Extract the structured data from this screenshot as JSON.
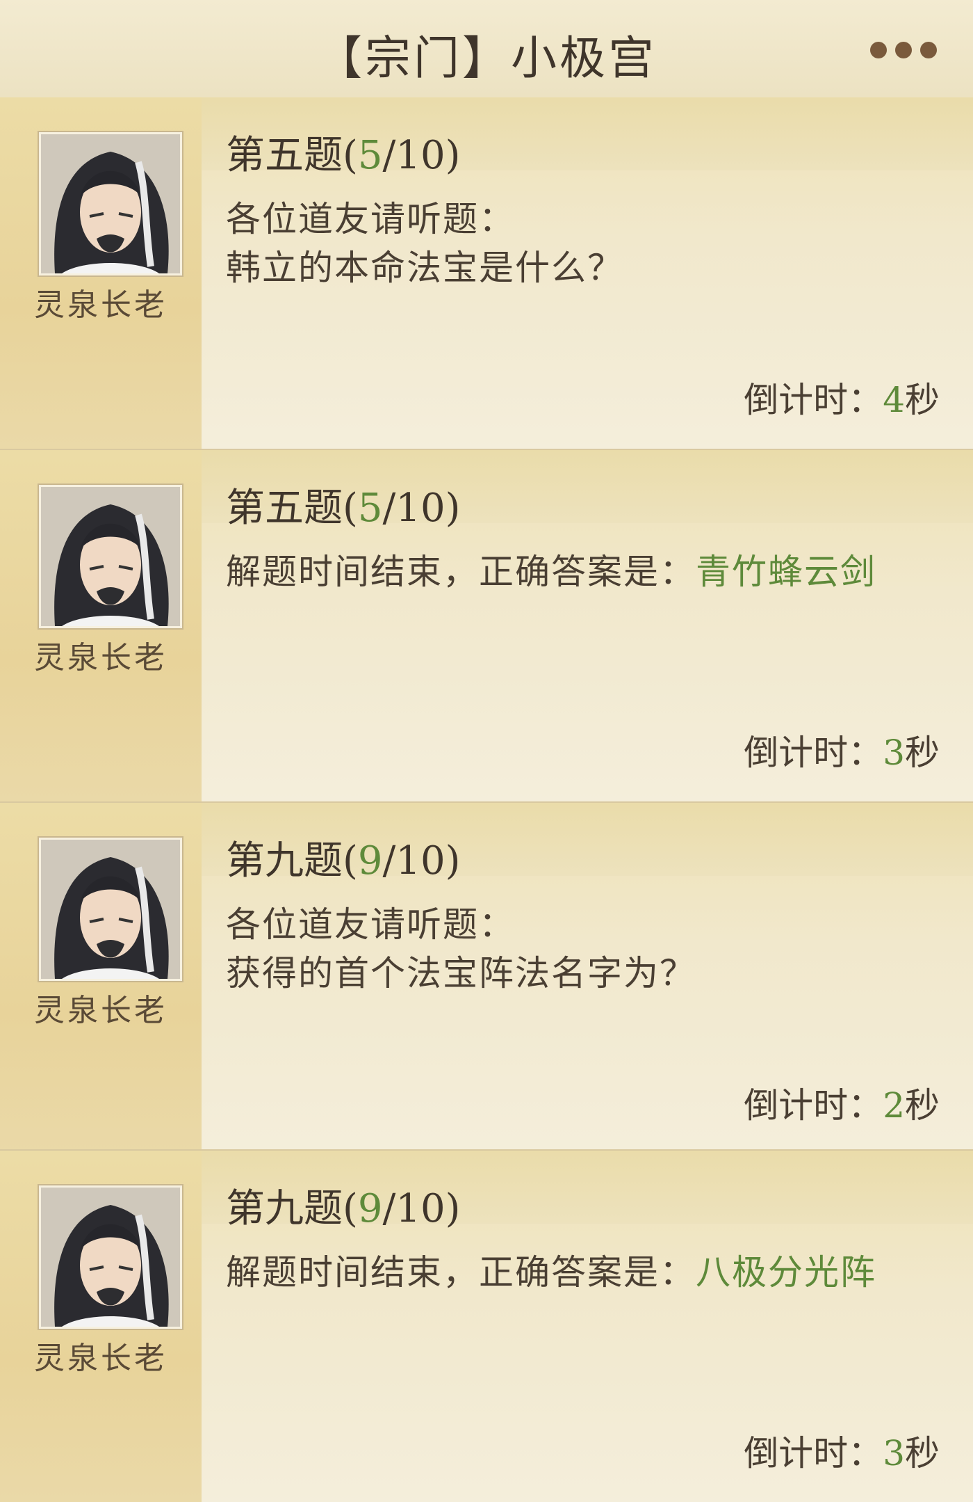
{
  "header": {
    "title": "【宗门】小极宫"
  },
  "messages": [
    {
      "npc_name": "灵泉长老",
      "q_label": "第五题",
      "q_index": "5",
      "q_total": "/10",
      "line1": "各位道友请听题：",
      "line2": "韩立的本命法宝是什么？",
      "answer_prefix": "",
      "answer": "",
      "countdown_label": "倒计时：",
      "countdown_value": "4",
      "countdown_unit": "秒"
    },
    {
      "npc_name": "灵泉长老",
      "q_label": "第五题",
      "q_index": "5",
      "q_total": "/10",
      "line1": "",
      "line2": "",
      "answer_prefix": "解题时间结束，正确答案是：",
      "answer": "青竹蜂云剑",
      "countdown_label": "倒计时：",
      "countdown_value": "3",
      "countdown_unit": "秒"
    },
    {
      "npc_name": "灵泉长老",
      "q_label": "第九题",
      "q_index": "9",
      "q_total": "/10",
      "line1": "各位道友请听题：",
      "line2": "获得的首个法宝阵法名字为？",
      "answer_prefix": "",
      "answer": "",
      "countdown_label": "倒计时：",
      "countdown_value": "2",
      "countdown_unit": "秒"
    },
    {
      "npc_name": "灵泉长老",
      "q_label": "第九题",
      "q_index": "9",
      "q_total": "/10",
      "line1": "",
      "line2": "",
      "answer_prefix": "解题时间结束，正确答案是：",
      "answer": "八极分光阵",
      "countdown_label": "倒计时：",
      "countdown_value": "3",
      "countdown_unit": "秒"
    }
  ]
}
